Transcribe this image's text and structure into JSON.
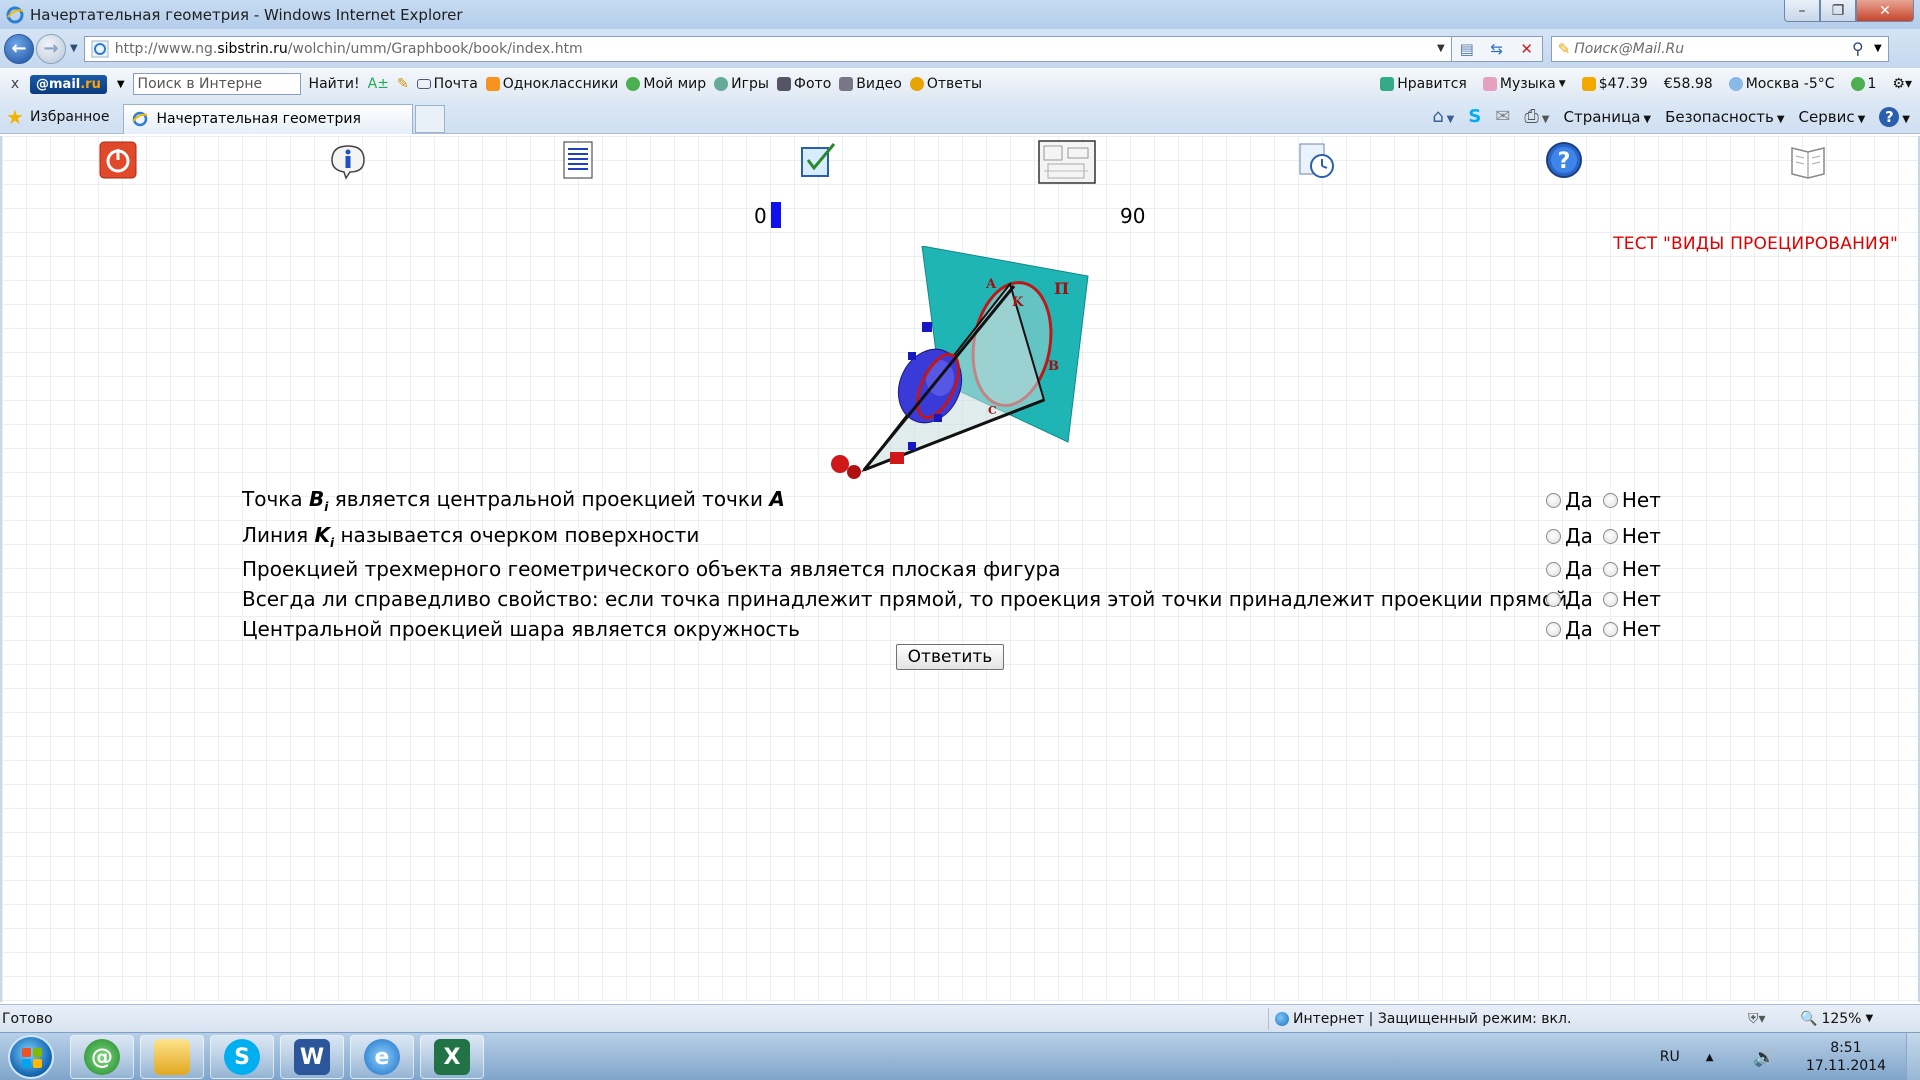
{
  "window": {
    "title": "Начертательная геометрия - Windows Internet Explorer",
    "controls": {
      "minimize": "–",
      "maximize": "❐",
      "close": "✕"
    }
  },
  "address_bar": {
    "url_prefix": "http://www.ng.",
    "url_domain": "sibstrin.ru",
    "url_path": "/wolchin/umm/Graphbook/book/index.htm",
    "search_placeholder": "Поиск@Mail.Ru"
  },
  "mail_toolbar": {
    "close": "x",
    "logo_text": "@mail",
    "logo_suffix": ".ru",
    "search_placeholder": "Поиск в Интерне",
    "find_button": "Найти!",
    "items": [
      "Почта",
      "Одноклассники",
      "Мой мир",
      "Игры",
      "Фото",
      "Видео",
      "Ответы"
    ],
    "right_items": [
      "Нравится",
      "Музыка",
      "$47.39",
      "€58.98",
      "Москва -5°C",
      "1"
    ]
  },
  "favorites_bar": {
    "favorites_label": "Избранное",
    "tab_title": "Начертательная геометрия",
    "commands": [
      "Страница",
      "Безопасность",
      "Сервис"
    ]
  },
  "content": {
    "score_min": "0",
    "score_max": "90",
    "score_fill": 0.03,
    "test_title": "ТЕСТ \"ВИДЫ ПРОЕЦИРОВАНИЯ\"",
    "figure_labels": {
      "plane": "П",
      "a": "A",
      "k": "K",
      "b": "B",
      "c": "C"
    },
    "questions": [
      {
        "before": "Точка ",
        "sym": "B",
        "sub": "i",
        "after": " является центральной проекцией точки ",
        "sym2": "A"
      },
      {
        "before": "Линия ",
        "sym": "K",
        "sub": "i",
        "after": " называется очерком поверхности",
        "sym2": ""
      },
      {
        "before": "Проекцией трехмерного геометрического объекта является плоская фигура",
        "sym": "",
        "sub": "",
        "after": "",
        "sym2": ""
      },
      {
        "before": "Всегда ли справедливо свойство: если точка принадлежит прямой, то проекция этой точки принадлежит проекции прямой",
        "sym": "",
        "sub": "",
        "after": "",
        "sym2": ""
      },
      {
        "before": "Центральной проекцией шара является окружность",
        "sym": "",
        "sub": "",
        "after": "",
        "sym2": ""
      }
    ],
    "option_yes": "Да",
    "option_no": "Нет",
    "answer_button": "Ответить"
  },
  "status_bar": {
    "status": "Готово",
    "zone": "Интернет | Защищенный режим: вкл.",
    "zoom": "125%"
  },
  "taskbar": {
    "language": "RU",
    "time": "8:51",
    "date": "17.11.2014"
  },
  "colors": {
    "accent_red": "#e00000",
    "score_bar": "#1010ee",
    "plane": "#1fb5b5"
  }
}
